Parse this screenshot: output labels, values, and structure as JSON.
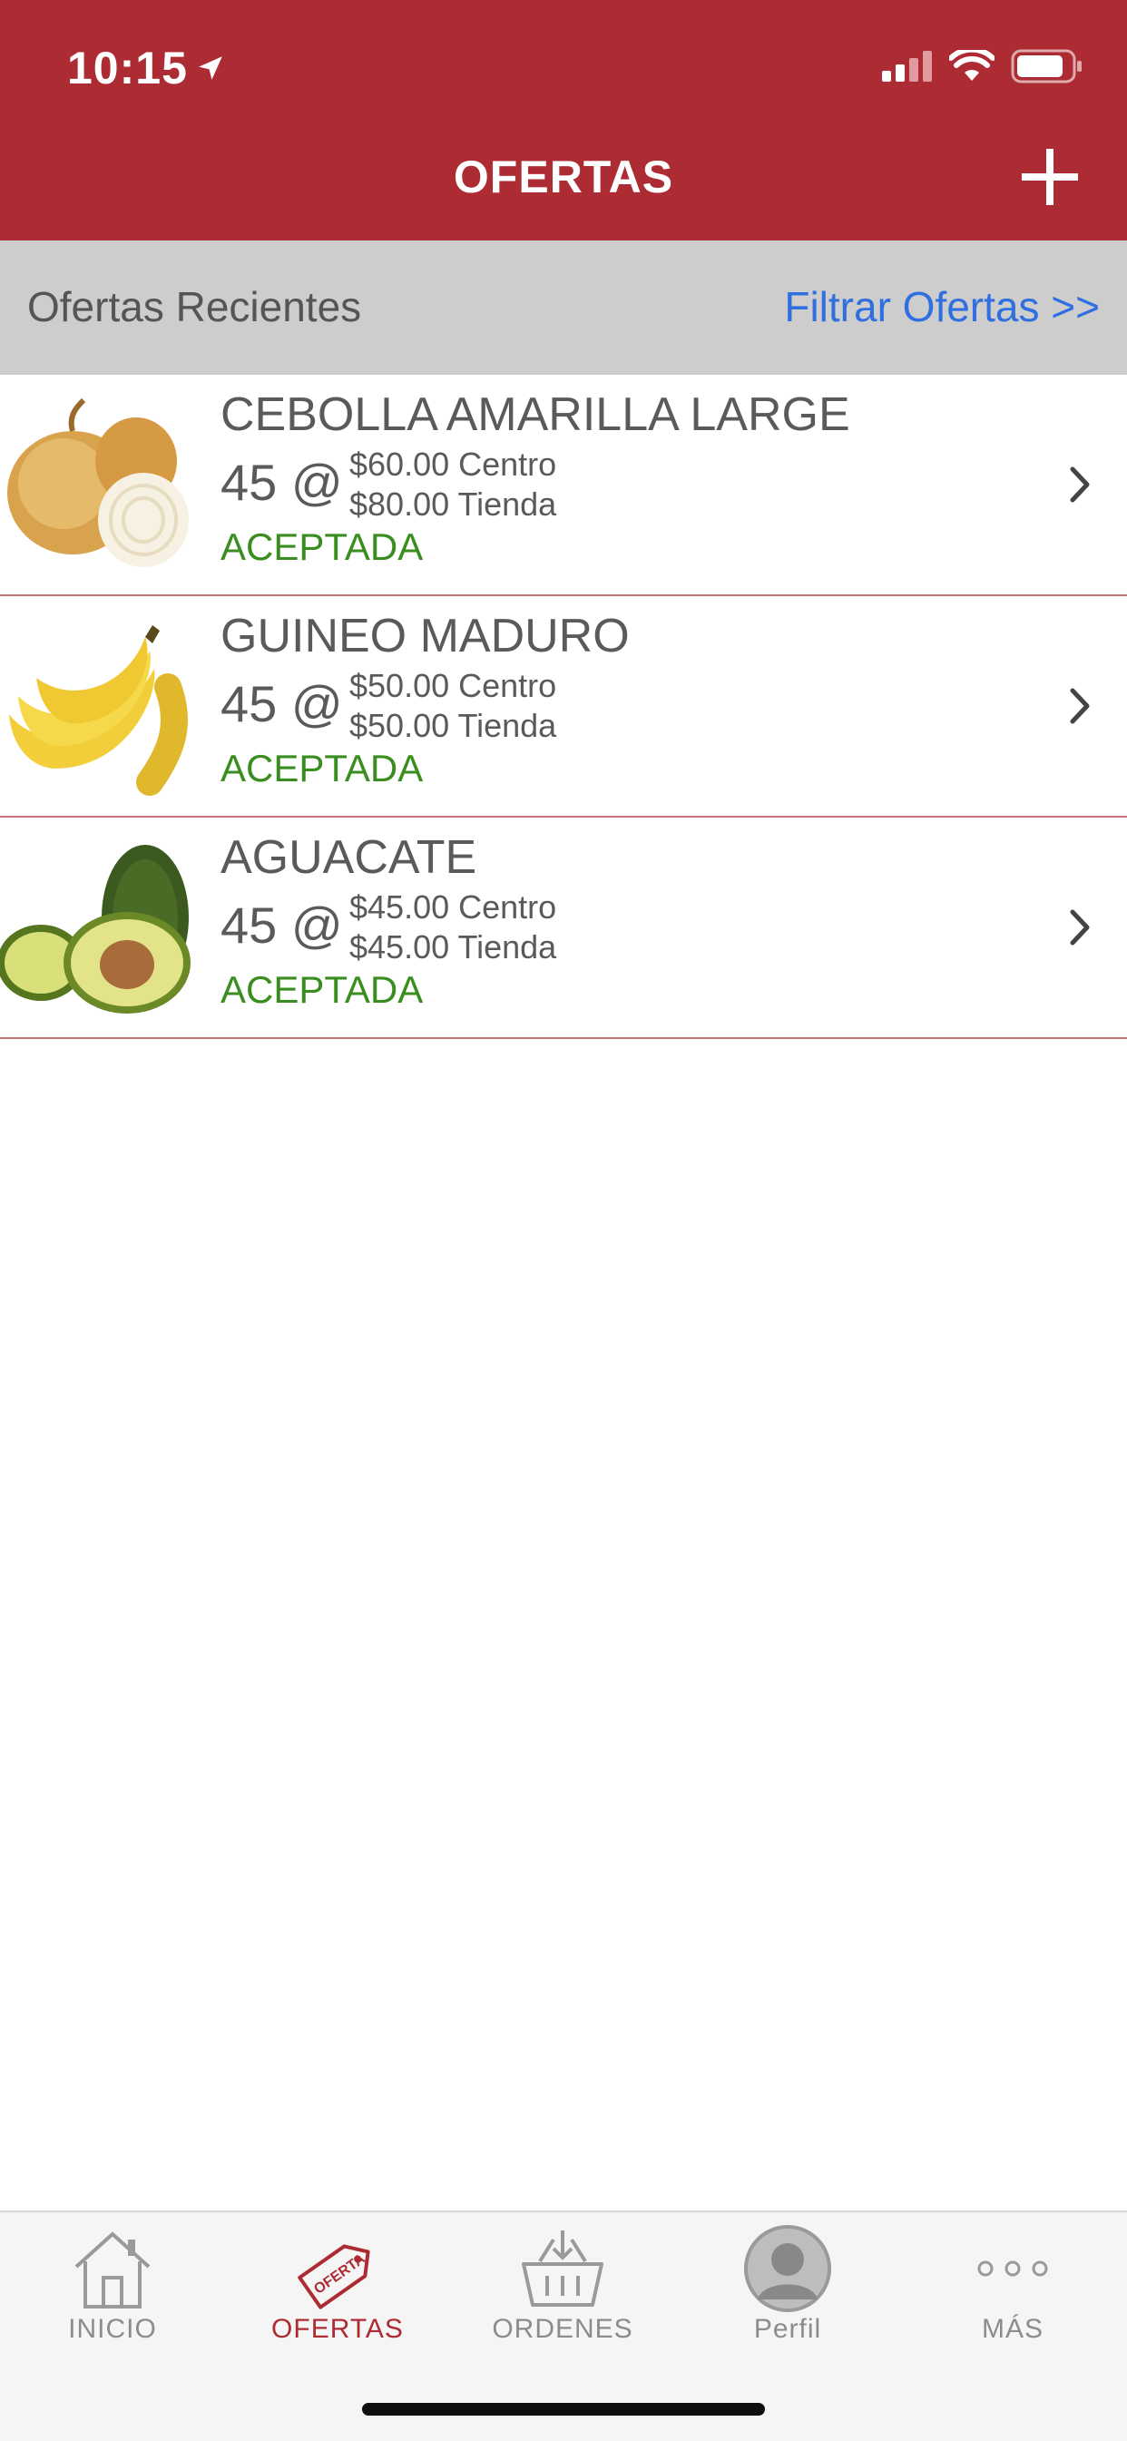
{
  "status_bar": {
    "time": "10:15"
  },
  "header": {
    "title": "OFERTAS",
    "add_icon": "plus-icon"
  },
  "section": {
    "title": "Ofertas Recientes",
    "filter_label": "Filtrar Ofertas >>"
  },
  "offers": [
    {
      "name": "CEBOLLA AMARILLA LARGE",
      "qty": "45 @",
      "price_centro": "$60.00 Centro",
      "price_tienda": "$80.00 Tienda",
      "status": "ACEPTADA",
      "image": "onion"
    },
    {
      "name": "GUINEO MADURO",
      "qty": "45 @",
      "price_centro": "$50.00 Centro",
      "price_tienda": "$50.00 Tienda",
      "status": "ACEPTADA",
      "image": "banana"
    },
    {
      "name": "AGUACATE",
      "qty": "45 @",
      "price_centro": "$45.00 Centro",
      "price_tienda": "$45.00 Tienda",
      "status": "ACEPTADA",
      "image": "avocado"
    }
  ],
  "tabs": [
    {
      "label": "INICIO",
      "icon": "home-icon",
      "active": false
    },
    {
      "label": "OFERTAS",
      "icon": "offer-tag-icon",
      "active": true,
      "icon_text": "OFERTA"
    },
    {
      "label": "ORDENES",
      "icon": "basket-icon",
      "active": false
    },
    {
      "label": "Perfil",
      "icon": "avatar-icon",
      "active": false
    },
    {
      "label": "MÁS",
      "icon": "more-icon",
      "active": false
    }
  ],
  "colors": {
    "brand": "#ad2c34",
    "accepted": "#3a8d1f",
    "link": "#2f6fe0"
  }
}
